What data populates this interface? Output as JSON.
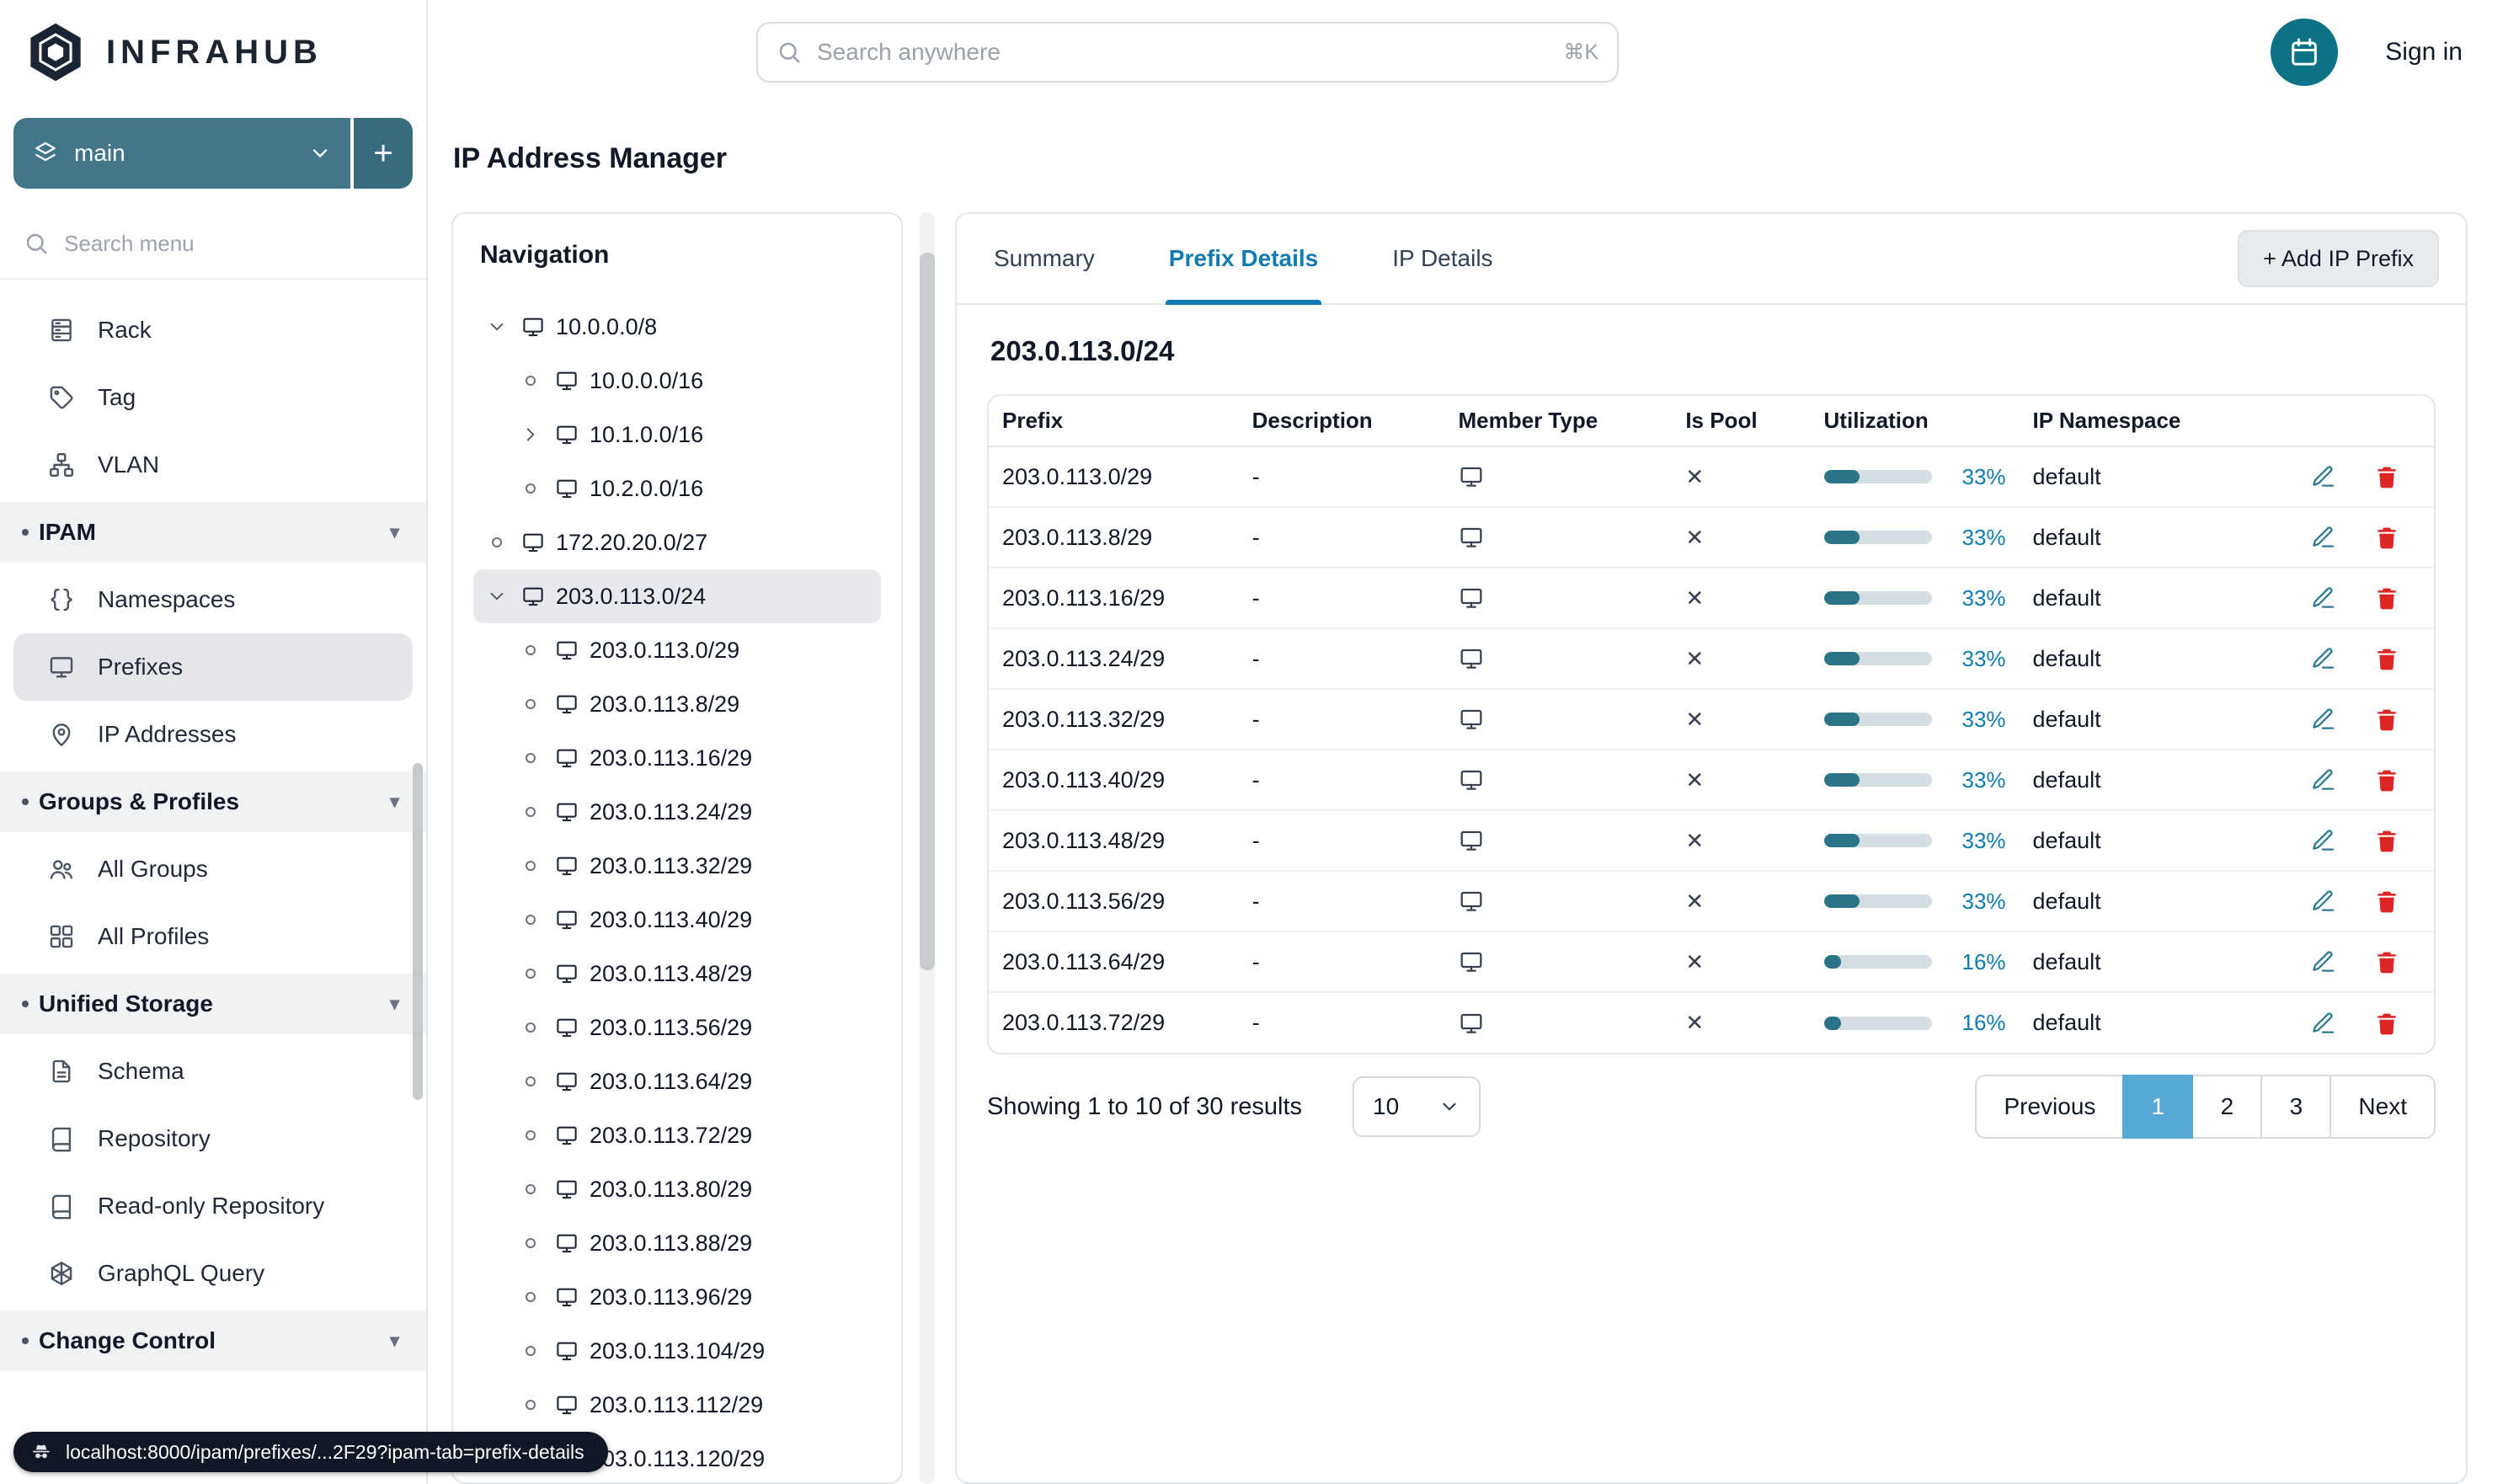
{
  "brand": {
    "name": "INFRAHUB"
  },
  "topbar": {
    "search_placeholder": "Search anywhere",
    "search_shortcut": "⌘K",
    "sign_in": "Sign in"
  },
  "page": {
    "title": "IP Address Manager"
  },
  "sidebar": {
    "branch": {
      "name": "main",
      "add_label": "+"
    },
    "search_placeholder": "Search menu",
    "menu": [
      {
        "type": "item",
        "label": "Rack",
        "icon": "rack"
      },
      {
        "type": "item",
        "label": "Tag",
        "icon": "tag"
      },
      {
        "type": "item",
        "label": "VLAN",
        "icon": "vlan"
      },
      {
        "type": "section",
        "label": "IPAM"
      },
      {
        "type": "item",
        "label": "Namespaces",
        "icon": "braces"
      },
      {
        "type": "item",
        "label": "Prefixes",
        "icon": "monitor",
        "selected": true
      },
      {
        "type": "item",
        "label": "IP Addresses",
        "icon": "pin"
      },
      {
        "type": "section",
        "label": "Groups & Profiles"
      },
      {
        "type": "item",
        "label": "All Groups",
        "icon": "users"
      },
      {
        "type": "item",
        "label": "All Profiles",
        "icon": "grid"
      },
      {
        "type": "section",
        "label": "Unified Storage"
      },
      {
        "type": "item",
        "label": "Schema",
        "icon": "doc"
      },
      {
        "type": "item",
        "label": "Repository",
        "icon": "book"
      },
      {
        "type": "item",
        "label": "Read-only Repository",
        "icon": "book"
      },
      {
        "type": "item",
        "label": "GraphQL Query",
        "icon": "hexnode"
      },
      {
        "type": "section",
        "label": "Change Control"
      }
    ],
    "status_url": "localhost:8000/ipam/prefixes/...2F29?ipam-tab=prefix-details"
  },
  "navigation": {
    "title": "Navigation",
    "tree": [
      {
        "label": "10.0.0.0/8",
        "level": 0,
        "expander": "down"
      },
      {
        "label": "10.0.0.0/16",
        "level": 1,
        "expander": "none"
      },
      {
        "label": "10.1.0.0/16",
        "level": 1,
        "expander": "right"
      },
      {
        "label": "10.2.0.0/16",
        "level": 1,
        "expander": "none"
      },
      {
        "label": "172.20.20.0/27",
        "level": 0,
        "expander": "none"
      },
      {
        "label": "203.0.113.0/24",
        "level": 0,
        "expander": "down",
        "selected": true
      },
      {
        "label": "203.0.113.0/29",
        "level": 1,
        "expander": "none"
      },
      {
        "label": "203.0.113.8/29",
        "level": 1,
        "expander": "none"
      },
      {
        "label": "203.0.113.16/29",
        "level": 1,
        "expander": "none"
      },
      {
        "label": "203.0.113.24/29",
        "level": 1,
        "expander": "none"
      },
      {
        "label": "203.0.113.32/29",
        "level": 1,
        "expander": "none"
      },
      {
        "label": "203.0.113.40/29",
        "level": 1,
        "expander": "none"
      },
      {
        "label": "203.0.113.48/29",
        "level": 1,
        "expander": "none"
      },
      {
        "label": "203.0.113.56/29",
        "level": 1,
        "expander": "none"
      },
      {
        "label": "203.0.113.64/29",
        "level": 1,
        "expander": "none"
      },
      {
        "label": "203.0.113.72/29",
        "level": 1,
        "expander": "none"
      },
      {
        "label": "203.0.113.80/29",
        "level": 1,
        "expander": "none"
      },
      {
        "label": "203.0.113.88/29",
        "level": 1,
        "expander": "none"
      },
      {
        "label": "203.0.113.96/29",
        "level": 1,
        "expander": "none"
      },
      {
        "label": "203.0.113.104/29",
        "level": 1,
        "expander": "none"
      },
      {
        "label": "203.0.113.112/29",
        "level": 1,
        "expander": "none"
      },
      {
        "label": "203.0.113.120/29",
        "level": 1,
        "expander": "none"
      }
    ]
  },
  "details": {
    "tabs": [
      {
        "label": "Summary",
        "active": false
      },
      {
        "label": "Prefix Details",
        "active": true
      },
      {
        "label": "IP Details",
        "active": false
      }
    ],
    "add_button": "+ Add IP Prefix",
    "heading": "203.0.113.0/24",
    "table": {
      "columns": [
        "Prefix",
        "Description",
        "Member Type",
        "Is Pool",
        "Utilization",
        "IP Namespace"
      ],
      "rows": [
        {
          "prefix": "203.0.113.0/29",
          "description": "-",
          "member_type": "prefix",
          "is_pool": false,
          "utilization": 33,
          "namespace": "default"
        },
        {
          "prefix": "203.0.113.8/29",
          "description": "-",
          "member_type": "prefix",
          "is_pool": false,
          "utilization": 33,
          "namespace": "default"
        },
        {
          "prefix": "203.0.113.16/29",
          "description": "-",
          "member_type": "prefix",
          "is_pool": false,
          "utilization": 33,
          "namespace": "default"
        },
        {
          "prefix": "203.0.113.24/29",
          "description": "-",
          "member_type": "prefix",
          "is_pool": false,
          "utilization": 33,
          "namespace": "default"
        },
        {
          "prefix": "203.0.113.32/29",
          "description": "-",
          "member_type": "prefix",
          "is_pool": false,
          "utilization": 33,
          "namespace": "default"
        },
        {
          "prefix": "203.0.113.40/29",
          "description": "-",
          "member_type": "prefix",
          "is_pool": false,
          "utilization": 33,
          "namespace": "default"
        },
        {
          "prefix": "203.0.113.48/29",
          "description": "-",
          "member_type": "prefix",
          "is_pool": false,
          "utilization": 33,
          "namespace": "default"
        },
        {
          "prefix": "203.0.113.56/29",
          "description": "-",
          "member_type": "prefix",
          "is_pool": false,
          "utilization": 33,
          "namespace": "default"
        },
        {
          "prefix": "203.0.113.64/29",
          "description": "-",
          "member_type": "prefix",
          "is_pool": false,
          "utilization": 16,
          "namespace": "default"
        },
        {
          "prefix": "203.0.113.72/29",
          "description": "-",
          "member_type": "prefix",
          "is_pool": false,
          "utilization": 16,
          "namespace": "default"
        }
      ]
    },
    "footer": {
      "showing": "Showing 1 to 10 of 30 results",
      "page_size": "10",
      "pagination": {
        "previous": "Previous",
        "pages": [
          "1",
          "2",
          "3"
        ],
        "active": "1",
        "next": "Next"
      }
    }
  },
  "colors": {
    "teal": "#40758a",
    "teal_dark": "#0d7285",
    "blue": "#0f7bb0",
    "progress": "#2b7487",
    "progress_track": "#d5dee2",
    "pagination_active": "#57a7d7",
    "danger": "#dc2626",
    "edit": "#2c7a91"
  }
}
